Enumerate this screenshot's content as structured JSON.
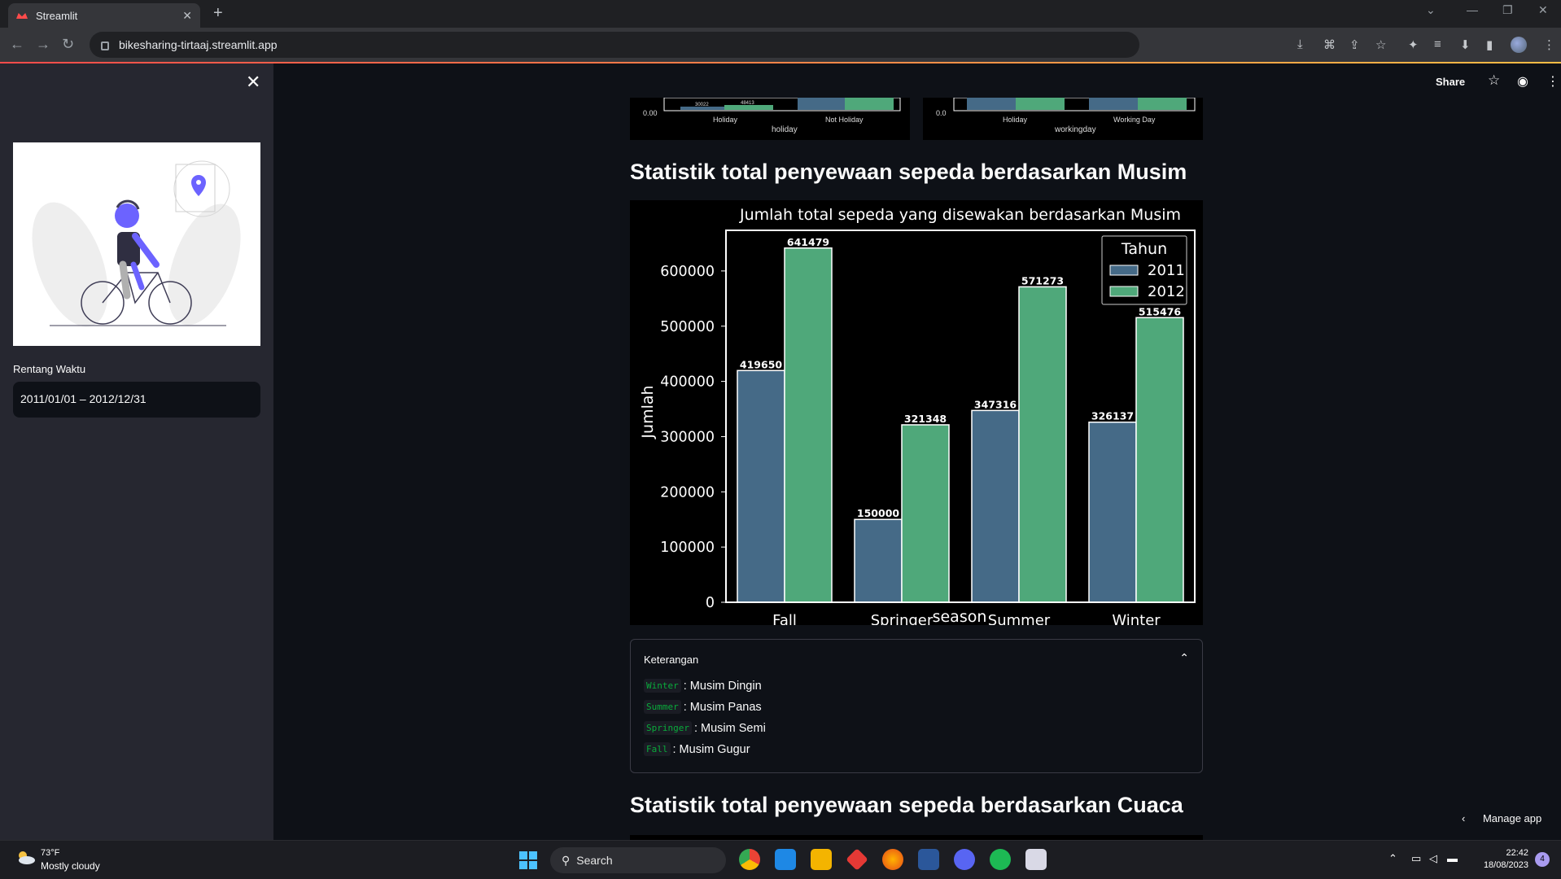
{
  "browser": {
    "tab_title": "Streamlit",
    "tab_close": "✕",
    "new_tab": "+",
    "url": "bikesharing-tirtaaj.streamlit.app"
  },
  "sidebar": {
    "close": "✕",
    "date_label": "Rentang Waktu",
    "date_value": "2011/01/01 – 2012/12/31"
  },
  "header": {
    "share": "Share"
  },
  "prev_charts": {
    "left": {
      "xlabel": "holiday",
      "ticks": [
        "Holiday",
        "Not Holiday"
      ],
      "ytick": "0.00",
      "labels": [
        "30022",
        "48413"
      ]
    },
    "right": {
      "xlabel": "workingday",
      "ticks": [
        "Holiday",
        "Working Day"
      ],
      "ytick": "0.0"
    }
  },
  "main": {
    "heading_musim": "Statistik total penyewaan sepeda berdasarkan Musim",
    "heading_cuaca": "Statistik total penyewaan sepeda berdasarkan Cuaca"
  },
  "chart_data": {
    "type": "bar",
    "title": "Jumlah total sepeda yang disewakan berdasarkan Musim",
    "xlabel": "season",
    "ylabel": "Jumlah",
    "categories": [
      "Fall",
      "Springer",
      "Summer",
      "Winter"
    ],
    "series": [
      {
        "name": "2011",
        "values": [
          419650,
          150000,
          347316,
          326137
        ],
        "color": "#456a87"
      },
      {
        "name": "2012",
        "values": [
          641479,
          321348,
          571273,
          515476
        ],
        "color": "#4fa87a"
      }
    ],
    "yticks": [
      0,
      100000,
      200000,
      300000,
      400000,
      500000,
      600000
    ],
    "ylim": [
      0,
      673553
    ],
    "legend_title": "Tahun",
    "legend_position": "upper-right",
    "background": "#000000",
    "grid": false
  },
  "keterangan": {
    "title": "Keterangan",
    "items": [
      {
        "code": "Winter",
        "text": ": Musim Dingin"
      },
      {
        "code": "Summer",
        "text": ": Musim Panas"
      },
      {
        "code": "Springer",
        "text": ": Musim Semi"
      },
      {
        "code": "Fall",
        "text": ": Musim Gugur"
      }
    ]
  },
  "manage_app": "Manage app",
  "taskbar": {
    "temp": "73°F",
    "weather": "Mostly cloudy",
    "search": "Search",
    "time": "22:42",
    "date": "18/08/2023",
    "notif_count": "4"
  }
}
